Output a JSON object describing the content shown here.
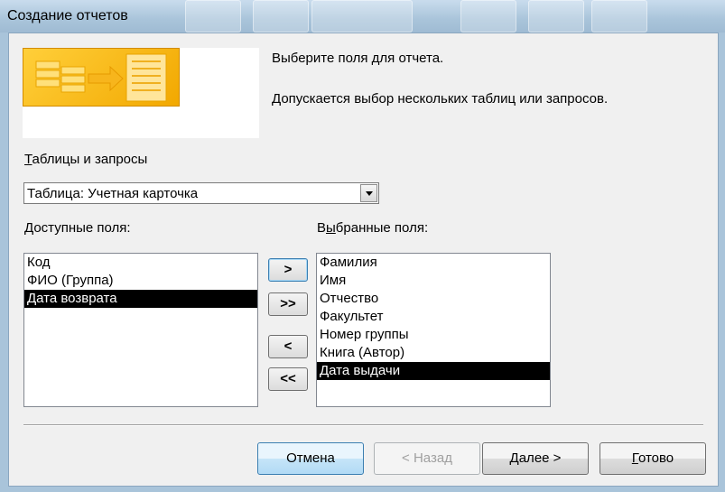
{
  "window": {
    "title": "Создание отчетов"
  },
  "header": {
    "line1": "Выберите поля для отчета.",
    "line2": "Допускается выбор нескольких таблиц или запросов."
  },
  "tables": {
    "label_prefix": "Т",
    "label_rest": "аблицы и запросы",
    "selected": "Таблица: Учетная карточка"
  },
  "available": {
    "label_prefix": "Д",
    "label_rest": "оступные поля:",
    "items": [
      "Код",
      "ФИО (Группа)",
      "Дата возврата"
    ],
    "selected_index": 2
  },
  "chosen": {
    "label_prefix": "В",
    "label_mid": "ы",
    "label_rest": "бранные поля:",
    "items": [
      "Фамилия",
      "Имя",
      "Отчество",
      "Факультет",
      "Номер группы",
      "Книга (Автор)",
      "Дата выдачи"
    ],
    "selected_index": 6
  },
  "move_buttons": {
    "add_one": ">",
    "add_all": ">>",
    "remove_one": "<",
    "remove_all": "<<"
  },
  "buttons": {
    "cancel": "Отмена",
    "back": "< Назад",
    "next_prefix": "Д",
    "next_rest": "алее >",
    "finish_prefix": "Г",
    "finish_rest": "отово"
  }
}
